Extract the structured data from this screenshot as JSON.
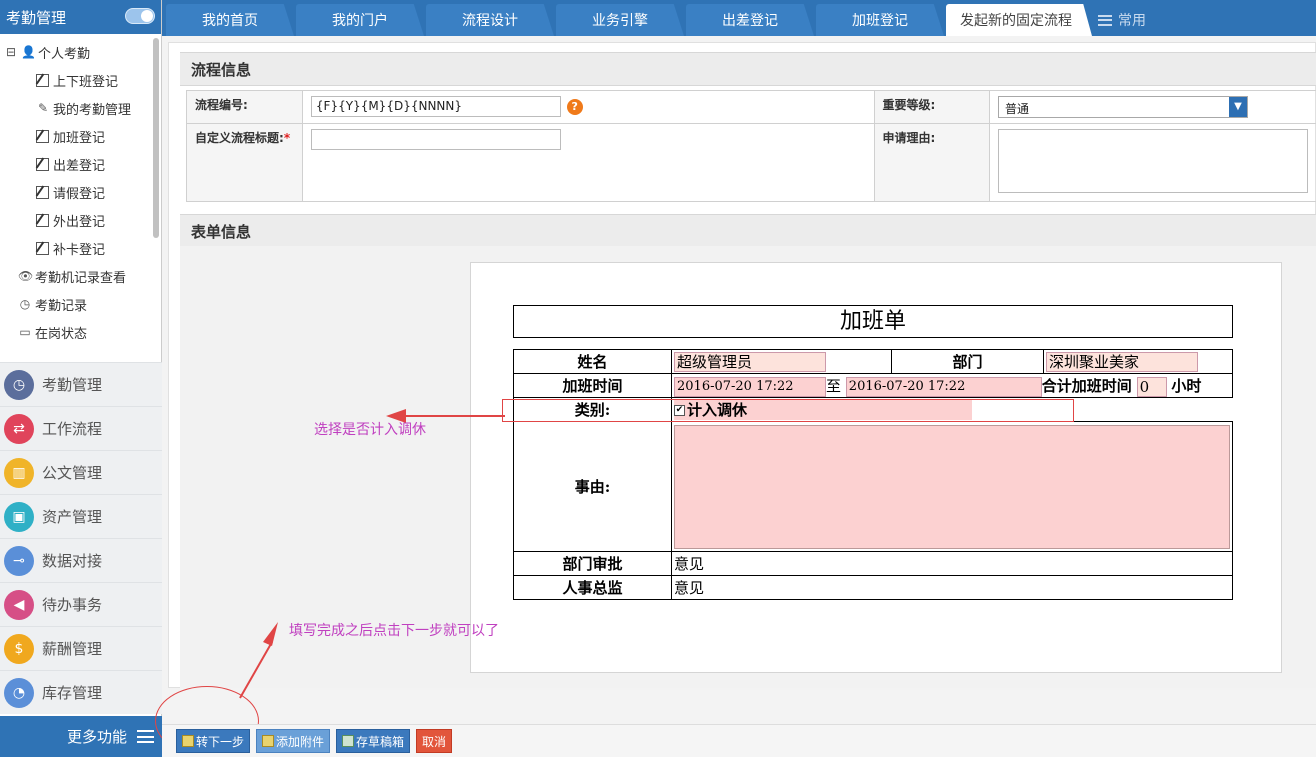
{
  "sidebar": {
    "title": "考勤管理",
    "tree": [
      {
        "label": "个人考勤",
        "level": 0,
        "icon": "user-icon"
      },
      {
        "label": "上下班登记",
        "level": 1,
        "icon": "edit-icon"
      },
      {
        "label": "我的考勤管理",
        "level": 1,
        "icon": "pencil-icon"
      },
      {
        "label": "加班登记",
        "level": 1,
        "icon": "edit-icon"
      },
      {
        "label": "出差登记",
        "level": 1,
        "icon": "edit-icon"
      },
      {
        "label": "请假登记",
        "level": 1,
        "icon": "edit-icon"
      },
      {
        "label": "外出登记",
        "level": 1,
        "icon": "edit-icon"
      },
      {
        "label": "补卡登记",
        "level": 1,
        "icon": "edit-icon"
      },
      {
        "label": "考勤机记录查看",
        "level": 0,
        "icon": "eye-icon"
      },
      {
        "label": "考勤记录",
        "level": 0,
        "icon": "clock-icon"
      },
      {
        "label": "在岗状态",
        "level": 0,
        "icon": "card-icon"
      }
    ],
    "menu": [
      {
        "label": "考勤管理",
        "color": "#5b6e9c",
        "icon": "clock-icon"
      },
      {
        "label": "工作流程",
        "color": "#e0445b",
        "icon": "flow-icon"
      },
      {
        "label": "公文管理",
        "color": "#f0b429",
        "icon": "document-icon"
      },
      {
        "label": "资产管理",
        "color": "#2fb0c6",
        "icon": "asset-icon"
      },
      {
        "label": "数据对接",
        "color": "#5a8fd8",
        "icon": "plug-icon"
      },
      {
        "label": "待办事务",
        "color": "#d64f86",
        "icon": "speaker-icon"
      },
      {
        "label": "薪酬管理",
        "color": "#f0a81e",
        "icon": "money-bag-icon"
      },
      {
        "label": "库存管理",
        "color": "#5b8fd8",
        "icon": "pie-icon"
      }
    ],
    "more_label": "更多功能"
  },
  "tabs": [
    {
      "label": "我的首页"
    },
    {
      "label": "我的门户"
    },
    {
      "label": "流程设计"
    },
    {
      "label": "业务引擎"
    },
    {
      "label": "出差登记"
    },
    {
      "label": "加班登记"
    },
    {
      "label": "发起新的固定流程"
    },
    {
      "label": "常用"
    }
  ],
  "flow": {
    "section_title": "流程信息",
    "number_label": "流程编号:",
    "number_value": "{F}{Y}{M}{D}{NNNN}",
    "help_mark": "?",
    "title_label": "自定义流程标题:",
    "required_mark": "*",
    "title_value": "",
    "level_label": "重要等级:",
    "level_value": "普通",
    "reason_label": "申请理由:"
  },
  "form": {
    "section_title": "表单信息",
    "doc_title": "加班单",
    "name_label": "姓名",
    "name_value": "超级管理员",
    "dept_label": "部门",
    "dept_value": "深圳聚业美家",
    "time_label": "加班时间",
    "start_time": "2016-07-20 17:22",
    "to_label": "至",
    "end_time": "2016-07-20 17:22",
    "total_label": "合计加班时间",
    "total_value": "0",
    "hours_unit": "小时",
    "type_label": "类别:",
    "type_check_label": "计入调休",
    "reason_label": "事由:",
    "dept_approval_label": "部门审批",
    "dept_approval_value": "意见",
    "hr_label": "人事总监",
    "hr_value": "意见"
  },
  "annotations": {
    "note1": "选择是否计入调休",
    "note2": "填写完成之后点击下一步就可以了"
  },
  "buttons": {
    "next": "转下一步",
    "attach": "添加附件",
    "draft": "存草稿箱",
    "cancel": "取消"
  },
  "colors": {
    "primary": "#2f73b5",
    "annotation": "#c040c0",
    "highlight_red": "#e04545",
    "field_pink": "#fcd1d1"
  }
}
